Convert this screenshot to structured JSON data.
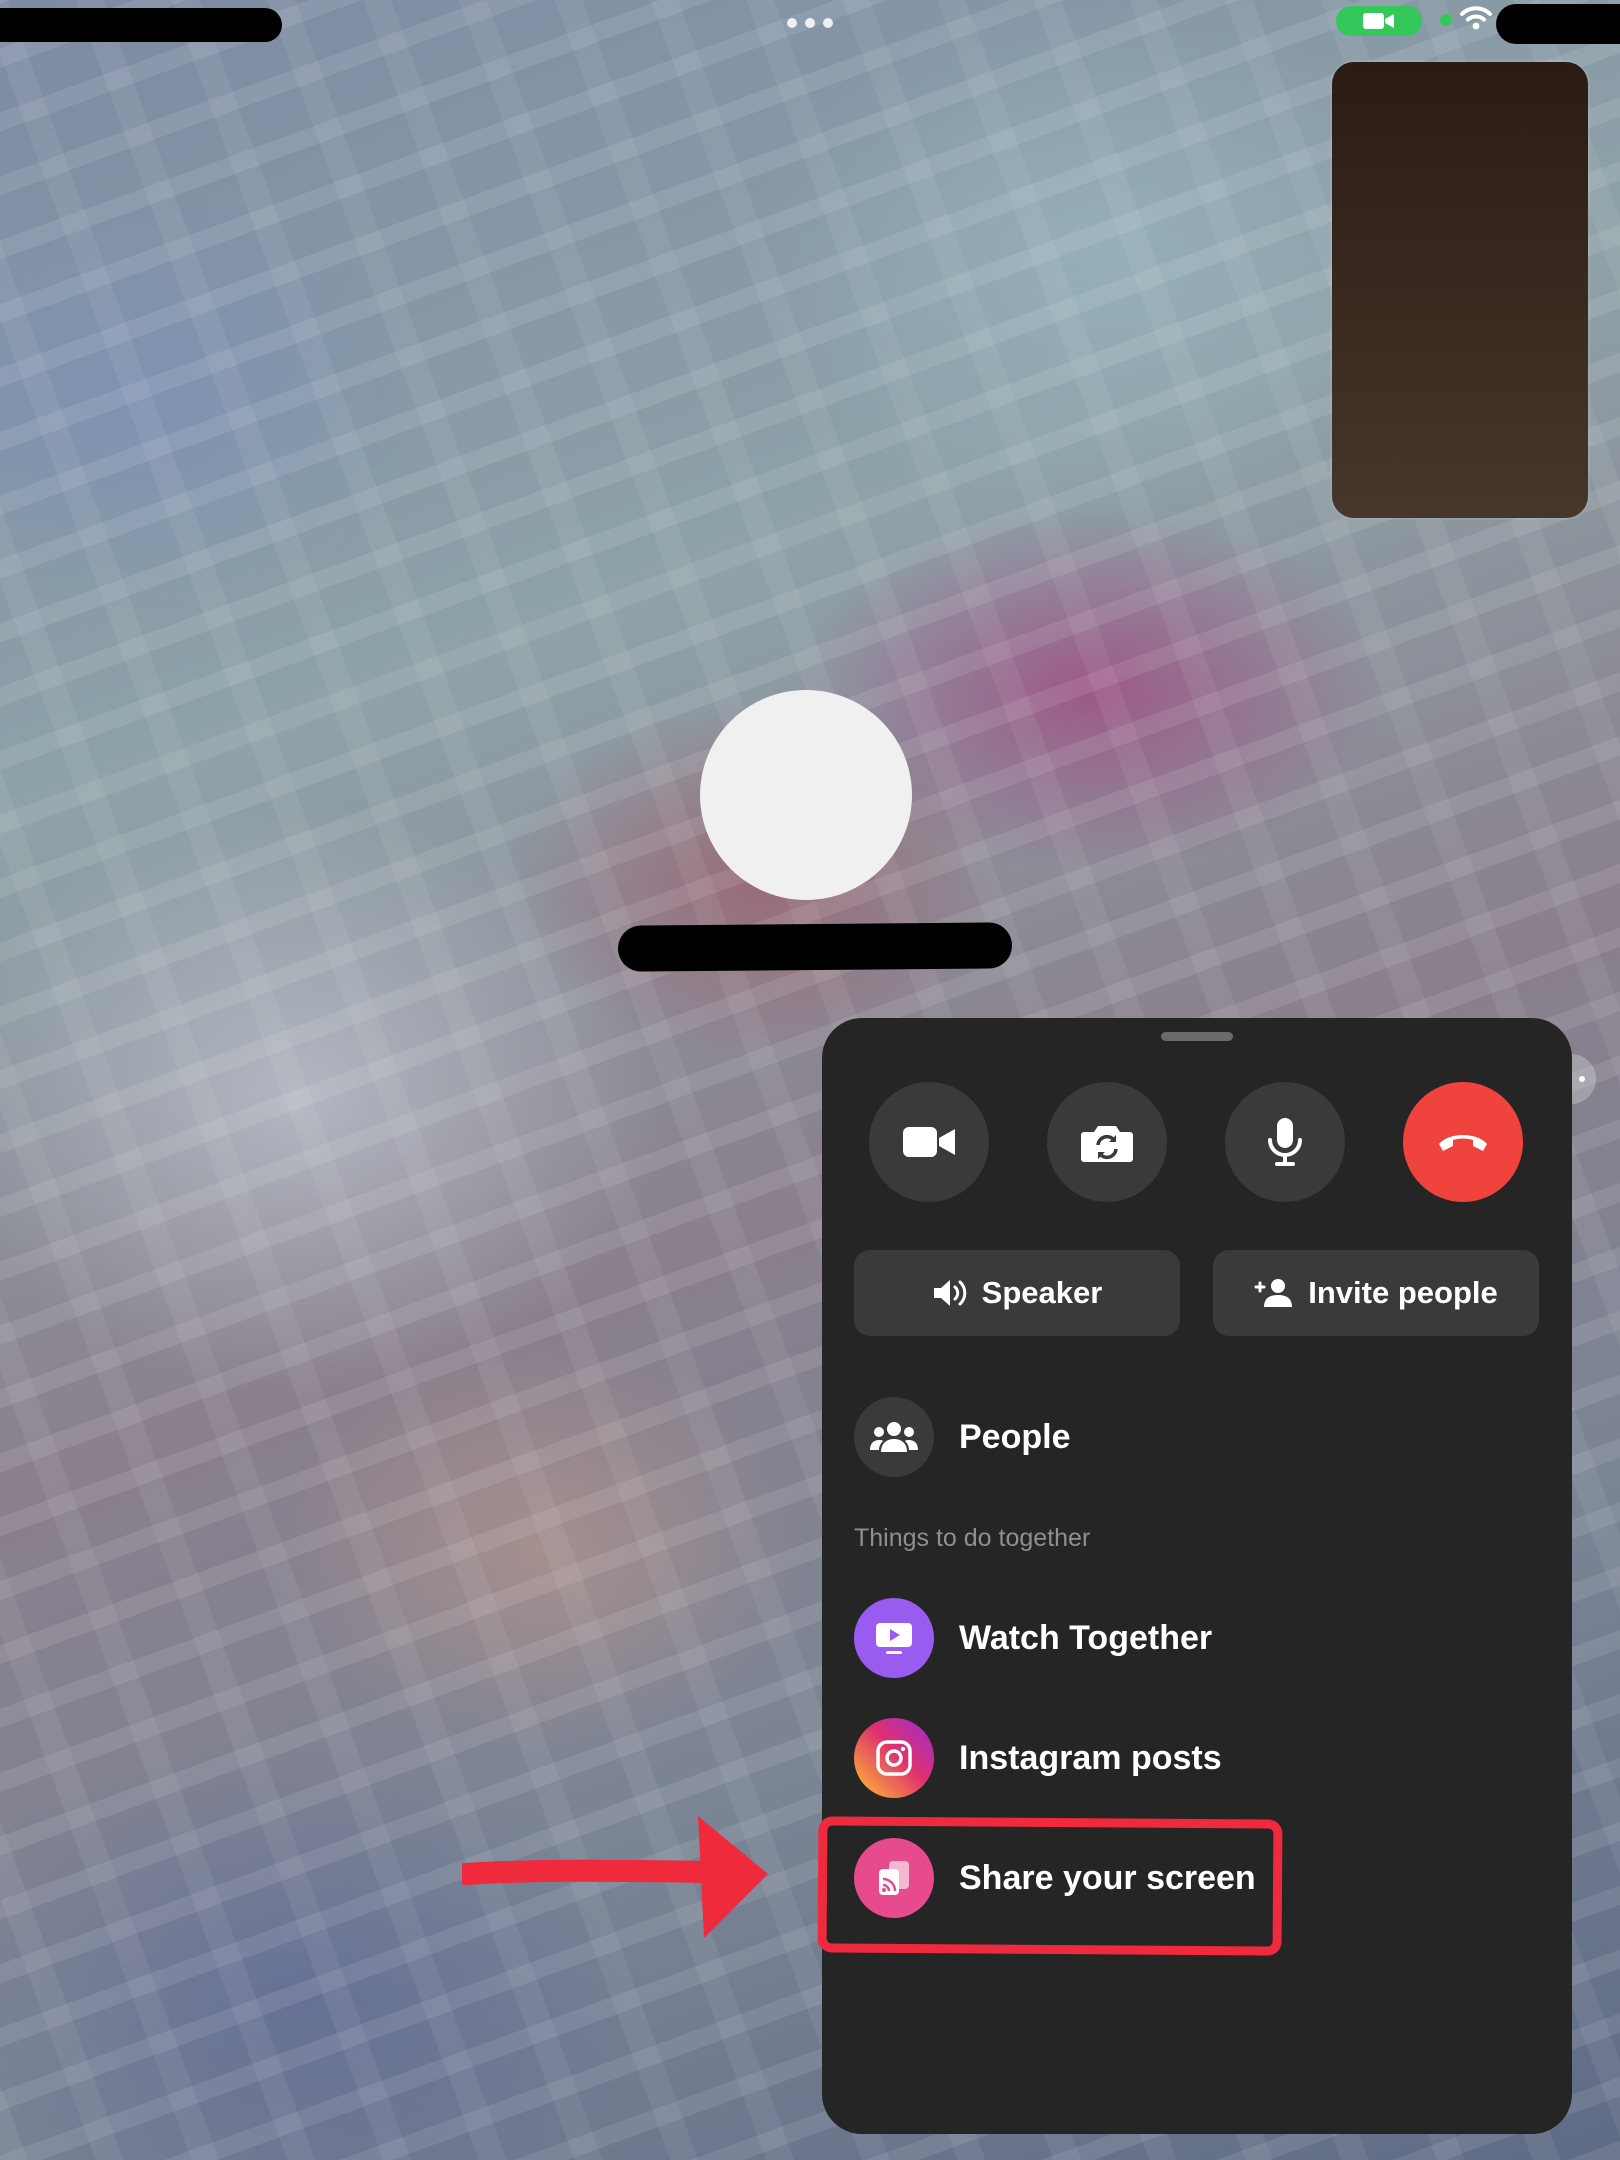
{
  "colors": {
    "sheet_bg": "#252526",
    "button_bg": "#3a3a3c",
    "end_call_red": "#f0433e",
    "status_green": "#34c759",
    "watch_together_purple": "#9a5cf0",
    "instagram_gradient": [
      "#f9a93a",
      "#e0306d",
      "#a02ec8"
    ],
    "share_screen_pink": "#e84b8d",
    "annotation_red": "#ee2a3c",
    "section_label_gray": "#8e8e93"
  },
  "status_bar": {
    "camera_indicator_icon": "video-camera-icon",
    "wifi_icon": "wifi-icon",
    "more_icon": "three-dots-icon"
  },
  "call_controls": {
    "buttons": [
      {
        "icon": "video-camera-icon"
      },
      {
        "icon": "flip-camera-icon"
      },
      {
        "icon": "microphone-icon"
      },
      {
        "icon": "end-call-icon"
      }
    ]
  },
  "audio": {
    "speaker_label": "Speaker",
    "speaker_icon": "speaker-icon"
  },
  "invite": {
    "label": "Invite people",
    "icon": "add-person-icon"
  },
  "people": {
    "label": "People",
    "icon": "group-icon"
  },
  "together": {
    "section_label": "Things to do together",
    "items": [
      {
        "label": "Watch Together",
        "icon": "play-screen-icon"
      },
      {
        "label": "Instagram posts",
        "icon": "instagram-icon"
      },
      {
        "label": "Share your screen",
        "icon": "screen-share-icon"
      }
    ]
  },
  "annotation": {
    "highlight": "Share your screen"
  }
}
